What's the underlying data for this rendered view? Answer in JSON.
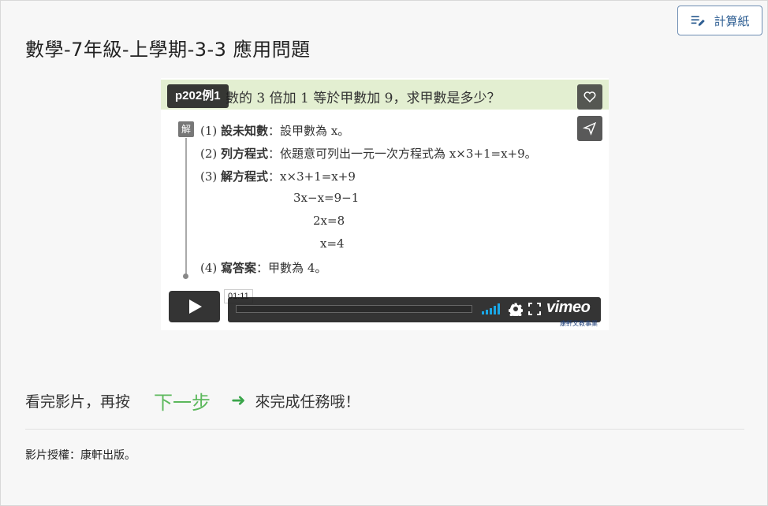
{
  "toolbar": {
    "calc_label": "計算紙"
  },
  "page": {
    "title": "數學-7年級-上學期-3-3 應用問題"
  },
  "video": {
    "badge": "p202例1",
    "question": "數的 3 倍加 1 等於甲數加 9，求甲數是多少？",
    "solution_icon": "解",
    "steps": [
      {
        "num": "(1)",
        "label": "設未知數",
        "text": "：設甲數為 x。"
      },
      {
        "num": "(2)",
        "label": "列方程式",
        "text": "：依題意可列出一元一次方程式為 x×3+1=x+9。"
      },
      {
        "num": "(3)",
        "label": "解方程式",
        "text": "：x×3+1=x+9"
      },
      {
        "num": "(4)",
        "label": "寫答案",
        "text": "：甲數為 4。"
      }
    ],
    "equations": [
      "3x−x=9−1",
      "2x=8",
      "x=4"
    ],
    "time": "01:11",
    "player_logo": "vimeo",
    "publisher": "康軒文教事業",
    "icons": [
      "heart-icon",
      "send-icon",
      "play-icon",
      "volume-icon",
      "gear-icon",
      "fullscreen-icon"
    ]
  },
  "instruction": {
    "before": "看完影片，再按",
    "next_label": "下一步",
    "arrow": "➜",
    "after": "來完成任務哦！"
  },
  "footer": {
    "copyright": "影片授權：康軒出版。"
  }
}
